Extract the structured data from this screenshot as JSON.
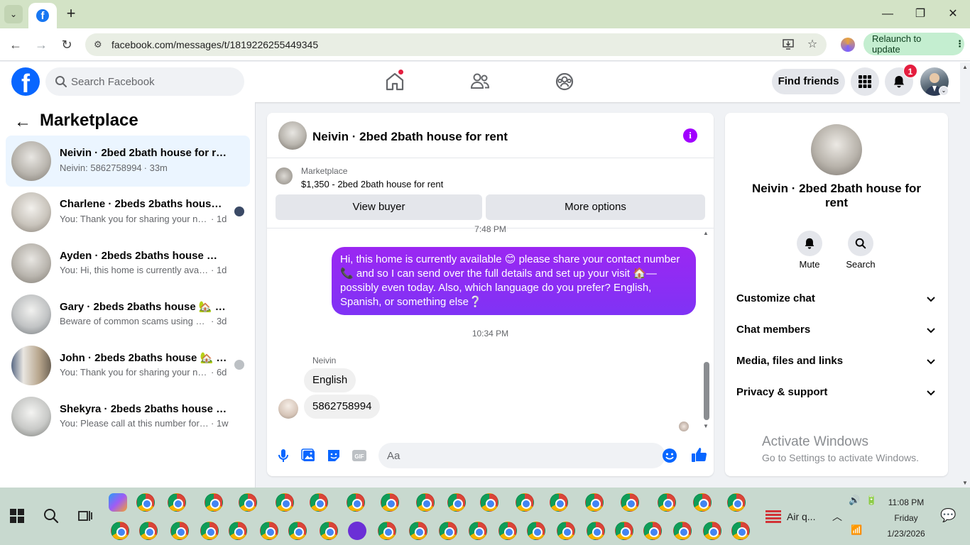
{
  "browser": {
    "url": "facebook.com/messages/t/1819226255449345",
    "relaunch_label": "Relaunch to update"
  },
  "fb": {
    "search_placeholder": "Search Facebook",
    "find_friends": "Find friends",
    "notification_count": "1",
    "accent": "#0866ff"
  },
  "left": {
    "title": "Marketplace",
    "conversations": [
      {
        "name": "Neivin · 2bed 2bath house for rent",
        "preview": "Neivin: 5862758994",
        "time": "· 33m",
        "active": true
      },
      {
        "name": "Charlene · 2beds 2baths house ...",
        "preview": "You: Thank you for sharing your nu...",
        "time": "· 1d"
      },
      {
        "name": "Ayden · 2beds 2baths house 🏡 fo...",
        "preview": "You: Hi, this home is currently availabl...",
        "time": "· 1d"
      },
      {
        "name": "Gary · 2beds 2baths house 🏡 for r...",
        "preview": "Beware of common scams using pay...",
        "time": "· 3d"
      },
      {
        "name": "John · 2beds 2baths house 🏡 f...",
        "preview": "You: Thank you for sharing your nu...",
        "time": "· 6d"
      },
      {
        "name": "Shekyra · 2beds 2baths house 🏡 f...",
        "preview": "You: Please call at this number for all ...",
        "time": "· 1w"
      }
    ]
  },
  "chat": {
    "title": "Neivin · 2bed 2bath house for rent",
    "marketplace_label": "Marketplace",
    "listing": "$1,350 - 2bed 2bath house for rent",
    "view_buyer": "View buyer",
    "more_options": "More options",
    "time_top": "7:48 PM",
    "outgoing": "Hi, this home is currently available 😊 please share your contact number 📞 and  so I can send over the full details and set up your visit 🏠—possibly even today. Also, which language do you prefer? English, Spanish, or something else❔",
    "time_mid": "10:34 PM",
    "sender": "Neivin",
    "incoming": [
      "English",
      "5862758994"
    ],
    "composer_placeholder": "Aa",
    "bubble_color": "#8a2be2"
  },
  "right": {
    "title": "Neivin · 2bed 2bath house for rent",
    "mute": "Mute",
    "search": "Search",
    "sections": [
      "Customize chat",
      "Chat members",
      "Media, files and links",
      "Privacy & support"
    ],
    "activate_title": "Activate Windows",
    "activate_sub": "Go to Settings to activate Windows."
  },
  "taskbar": {
    "aq_label": "Air q...",
    "time": "11:08 PM",
    "day": "Friday",
    "date": "1/23/2026"
  }
}
